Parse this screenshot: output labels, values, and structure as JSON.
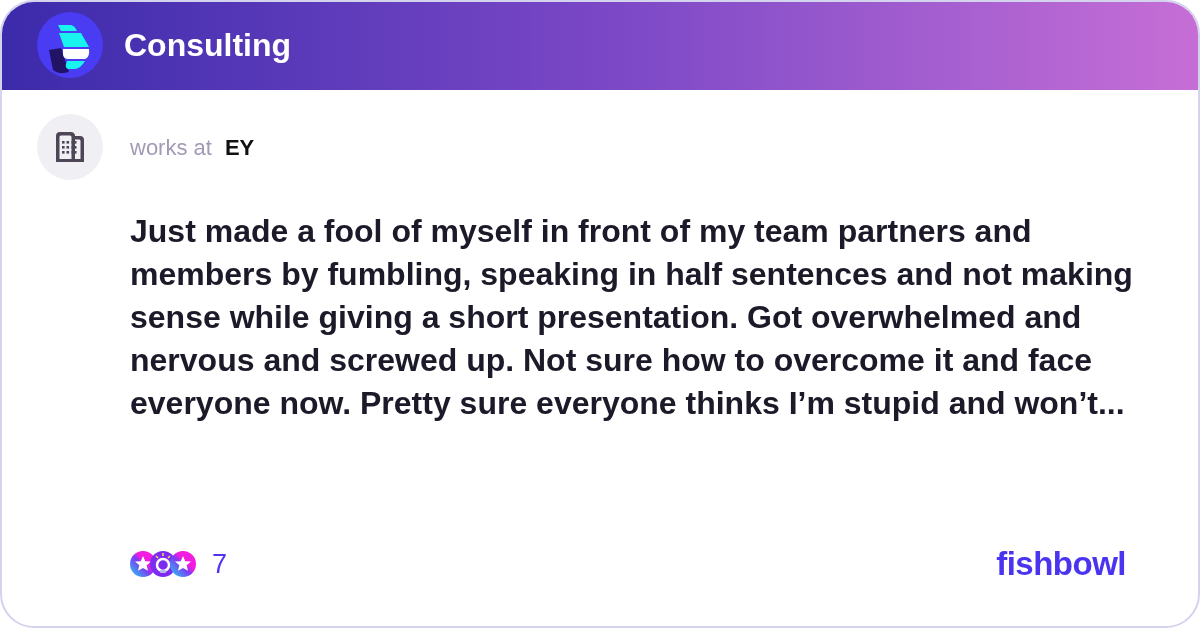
{
  "header": {
    "title": "Consulting"
  },
  "author": {
    "label": "works at",
    "company": "EY"
  },
  "post": {
    "text": "Just made a fool of myself in front of my team partners and members by fumbling, speaking in half sentences and not making sense while giving a short presentation. Got overwhelmed and nervous and screwed up. Not sure how to overcome it and face everyone now. Pretty sure everyone thinks I’m stupid and won’t..."
  },
  "footer": {
    "reactions": [
      {
        "kind": "star"
      },
      {
        "kind": "bulb"
      },
      {
        "kind": "star"
      }
    ],
    "reaction_count": "7",
    "brand": "fishbowl"
  }
}
